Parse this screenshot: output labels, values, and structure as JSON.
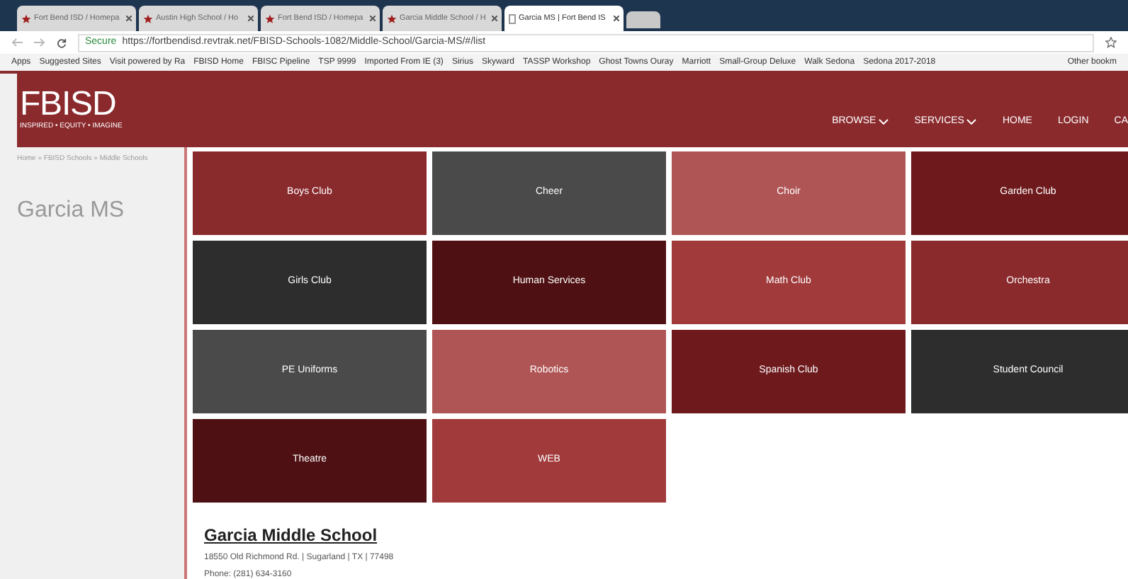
{
  "browser": {
    "tabs": [
      {
        "title": "Fort Bend ISD / Homepa",
        "selected": false
      },
      {
        "title": "Austin High School / Ho",
        "selected": false
      },
      {
        "title": "Fort Bend ISD / Homepa",
        "selected": false
      },
      {
        "title": "Garcia Middle School / H",
        "selected": false
      },
      {
        "title": "Garcia MS | Fort Bend IS",
        "selected": true
      }
    ],
    "secure_label": "Secure",
    "url": "https://fortbendisd.revtrak.net/FBISD-Schools-1082/Middle-School/Garcia-MS/#/list",
    "bookmarks": [
      "Apps",
      "Suggested Sites",
      "Visit powered by Ra",
      "FBISD Home",
      "FBISC Pipeline",
      "TSP 9999",
      "Imported From IE (3)",
      "Sirius",
      "Skyward",
      "TASSP Workshop",
      "Ghost Towns Ouray",
      "Marriott",
      "Small-Group Deluxe",
      "Walk Sedona",
      "Sedona 2017-2018"
    ],
    "other_bookmarks": "Other bookm"
  },
  "site": {
    "logo": "FBISD",
    "tagline": "INSPIRED • EQUITY • IMAGINE",
    "nav": [
      {
        "label": "BROWSE",
        "kind": "dropdown"
      },
      {
        "label": "SERVICES",
        "kind": "dropdown"
      },
      {
        "label": "HOME",
        "kind": "link"
      },
      {
        "label": "LOGIN",
        "kind": "link"
      },
      {
        "label": "CA",
        "kind": "link"
      }
    ]
  },
  "breadcrumb": "Home » FBISD Schools » Middle Schools",
  "page_title": "Garcia MS",
  "tiles": [
    {
      "label": "Boys Club",
      "color": "#892a2d"
    },
    {
      "label": "Cheer",
      "color": "#4a4a4a"
    },
    {
      "label": "Choir",
      "color": "#b05555"
    },
    {
      "label": "Garden Club",
      "color": "#6e1a1d"
    },
    {
      "label": "Girls Club",
      "color": "#2d2d2d"
    },
    {
      "label": "Human Services",
      "color": "#4e1012"
    },
    {
      "label": "Math Club",
      "color": "#a03a3b"
    },
    {
      "label": "Orchestra",
      "color": "#8a2a2c"
    },
    {
      "label": "PE Uniforms",
      "color": "#4a4a4a"
    },
    {
      "label": "Robotics",
      "color": "#b05555"
    },
    {
      "label": "Spanish Club",
      "color": "#6e1a1d"
    },
    {
      "label": "Student Council",
      "color": "#2d2d2d"
    },
    {
      "label": "Theatre",
      "color": "#4e1012"
    },
    {
      "label": "WEB",
      "color": "#a03a3b"
    }
  ],
  "school": {
    "name": "Garcia Middle School",
    "address": "18550 Old Richmond Rd. | Sugarland | TX | 77498",
    "phone": "Phone: (281) 634-3160"
  }
}
